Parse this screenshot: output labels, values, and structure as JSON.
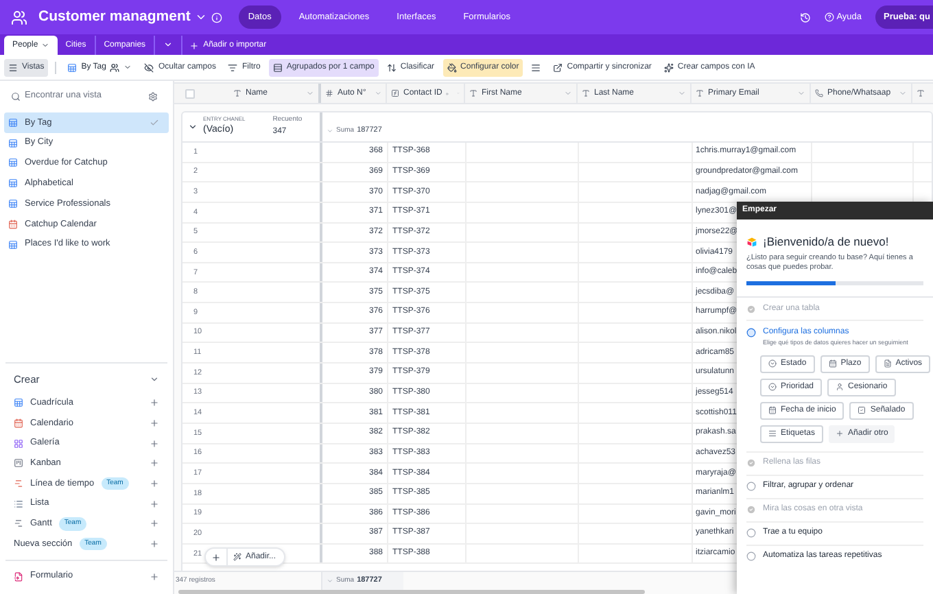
{
  "app": {
    "title": "Customer managment",
    "nav": [
      {
        "label": "Datos",
        "selected": true
      },
      {
        "label": "Automatizaciones",
        "selected": false
      },
      {
        "label": "Interfaces",
        "selected": false
      },
      {
        "label": "Formularios",
        "selected": false
      }
    ],
    "help": "Ayuda",
    "trial": "Prueba: qu"
  },
  "tables": {
    "tabs": [
      {
        "label": "People",
        "selected": true
      },
      {
        "label": "Cities",
        "selected": false
      },
      {
        "label": "Companies",
        "selected": false
      }
    ],
    "add": "Añadir o importar"
  },
  "toolbar": [
    {
      "kind": "views",
      "label": "Vistas",
      "active": true
    },
    {
      "kind": "view",
      "label": "By Tag",
      "active": false
    },
    {
      "kind": "hide",
      "label": "Ocultar campos",
      "active": false
    },
    {
      "kind": "filter",
      "label": "Filtro",
      "active": false
    },
    {
      "kind": "group",
      "label": "Agrupados por 1 campo",
      "active": true
    },
    {
      "kind": "sort",
      "label": "Clasificar",
      "active": false
    },
    {
      "kind": "color",
      "label": "Configurar color",
      "active": true
    },
    {
      "kind": "height",
      "active": false
    },
    {
      "kind": "share",
      "label": "Compartir y sincronizar",
      "active": false
    },
    {
      "kind": "ai",
      "label": "Crear campos con IA",
      "active": false
    }
  ],
  "sidebar": {
    "search": {
      "placeholder": "Encontrar una vista"
    },
    "views": [
      {
        "kind": "grid",
        "label": "By Tag",
        "selected": true
      },
      {
        "kind": "grid",
        "label": "By City",
        "selected": false
      },
      {
        "kind": "grid",
        "label": "Overdue for Catchup",
        "selected": false
      },
      {
        "kind": "grid",
        "label": "Alphabetical",
        "selected": false
      },
      {
        "kind": "grid",
        "label": "Service Professionals",
        "selected": false
      },
      {
        "kind": "calendar",
        "label": "Catchup Calendar",
        "selected": false
      },
      {
        "kind": "grid",
        "label": "Places I'd like to work",
        "selected": false
      }
    ],
    "create_title": "Crear",
    "create": [
      {
        "kind": "grid",
        "label": "Cuadrícula"
      },
      {
        "kind": "calendar",
        "label": "Calendario"
      },
      {
        "kind": "gallery",
        "label": "Galería"
      },
      {
        "kind": "kanban",
        "label": "Kanban"
      },
      {
        "kind": "timeline",
        "label": "Línea de tiempo",
        "badge": "Team"
      },
      {
        "kind": "list",
        "label": "Lista"
      },
      {
        "kind": "gantt",
        "label": "Gantt",
        "badge": "Team"
      },
      {
        "kind": "section",
        "label": "Nueva sección",
        "badge": "Team"
      }
    ],
    "extra": [
      {
        "kind": "form",
        "label": "Formulario"
      }
    ]
  },
  "table": {
    "select_all": {
      "checked": false
    },
    "columns": [
      {
        "kind": "text",
        "label": "Name"
      },
      {
        "kind": "number",
        "label": "Auto N°"
      },
      {
        "kind": "formula",
        "label": "Contact ID"
      },
      {
        "kind": "text",
        "label": "First Name"
      },
      {
        "kind": "text",
        "label": "Last Name"
      },
      {
        "kind": "text",
        "label": "Primary Email"
      },
      {
        "kind": "phone",
        "label": "Phone/Whatsaap"
      },
      {
        "kind": "text"
      }
    ],
    "group": {
      "field": "ENTRY CHANEL",
      "value": "(Vacío)",
      "count_label": "Recuento",
      "count": "347",
      "sum_label": "Suma",
      "sum": "187727"
    },
    "rows": [
      {
        "row": "1",
        "auto": "368",
        "contact_id": "TTSP-368",
        "email": "1chris.murray1@gmail.com"
      },
      {
        "row": "2",
        "auto": "369",
        "contact_id": "TTSP-369",
        "email": "groundpredator@gmail.com"
      },
      {
        "row": "3",
        "auto": "370",
        "contact_id": "TTSP-370",
        "email": "nadjag@gmail.com"
      },
      {
        "row": "4",
        "auto": "371",
        "contact_id": "TTSP-371",
        "email": "lynez301@"
      },
      {
        "row": "5",
        "auto": "372",
        "contact_id": "TTSP-372",
        "email": "jmorse22@"
      },
      {
        "row": "6",
        "auto": "373",
        "contact_id": "TTSP-373",
        "email": "olivia4179"
      },
      {
        "row": "7",
        "auto": "374",
        "contact_id": "TTSP-374",
        "email": "info@caleb"
      },
      {
        "row": "8",
        "auto": "375",
        "contact_id": "TTSP-375",
        "email": "jecsdiba@"
      },
      {
        "row": "9",
        "auto": "376",
        "contact_id": "TTSP-376",
        "email": "harrumpf@"
      },
      {
        "row": "10",
        "auto": "377",
        "contact_id": "TTSP-377",
        "email": "alison.nikol"
      },
      {
        "row": "11",
        "auto": "378",
        "contact_id": "TTSP-378",
        "email": "adricam85"
      },
      {
        "row": "12",
        "auto": "379",
        "contact_id": "TTSP-379",
        "email": "ursulatunn"
      },
      {
        "row": "13",
        "auto": "380",
        "contact_id": "TTSP-380",
        "email": "jesseg514"
      },
      {
        "row": "14",
        "auto": "381",
        "contact_id": "TTSP-381",
        "email": "scottish011"
      },
      {
        "row": "15",
        "auto": "382",
        "contact_id": "TTSP-382",
        "email": "prakash.sa"
      },
      {
        "row": "16",
        "auto": "383",
        "contact_id": "TTSP-383",
        "email": "achavez53"
      },
      {
        "row": "17",
        "auto": "384",
        "contact_id": "TTSP-384",
        "email": "maryraja@"
      },
      {
        "row": "18",
        "auto": "385",
        "contact_id": "TTSP-385",
        "email": "marianlm1"
      },
      {
        "row": "19",
        "auto": "386",
        "contact_id": "TTSP-386",
        "email": "gavin_mori"
      },
      {
        "row": "20",
        "auto": "387",
        "contact_id": "TTSP-387",
        "email": "yanethkari"
      },
      {
        "row": "21",
        "auto": "388",
        "contact_id": "TTSP-388",
        "email": "itziarcamio"
      }
    ],
    "add_button": "Añadir...",
    "footer": {
      "records": "347 registros",
      "sum_label": "Suma",
      "sum": "187727"
    }
  },
  "panel": {
    "title": "Empezar",
    "heading": "¡Bienvenido/a de nuevo!",
    "intro": "¿Listo para seguir creando tu base? Aquí tienes a cosas que puedes probar.",
    "level": 0.5,
    "steps": [
      {
        "label": "Crear una tabla",
        "done": true,
        "active": false
      },
      {
        "label": "Configura las columnas",
        "done": false,
        "active": true,
        "hint": "Elige qué tipos de datos quieres hacer un seguimient",
        "options": [
          [
            {
              "kind": "status",
              "label": "Estado"
            },
            {
              "kind": "date",
              "label": "Plazo"
            },
            {
              "kind": "file",
              "label": "Activos"
            }
          ],
          [
            {
              "kind": "status",
              "label": "Prioridad"
            },
            {
              "kind": "user",
              "label": "Cesionario"
            }
          ],
          [
            {
              "kind": "date",
              "label": "Fecha de inicio"
            },
            {
              "kind": "check",
              "label": "Señalado"
            }
          ],
          [
            {
              "kind": "list",
              "label": "Etiquetas"
            },
            {
              "kind": "add",
              "label": "Añadir otro"
            }
          ]
        ]
      },
      {
        "label": "Rellena las filas",
        "done": true,
        "active": false
      },
      {
        "label": "Filtrar, agrupar y ordenar",
        "done": false,
        "active": false
      },
      {
        "label": "Mira las cosas en otra vista",
        "done": true,
        "active": false
      },
      {
        "label": "Trae a tu equipo",
        "done": false,
        "active": false
      },
      {
        "label": "Automatiza las tareas repetitivas",
        "done": false,
        "active": false
      }
    ]
  }
}
